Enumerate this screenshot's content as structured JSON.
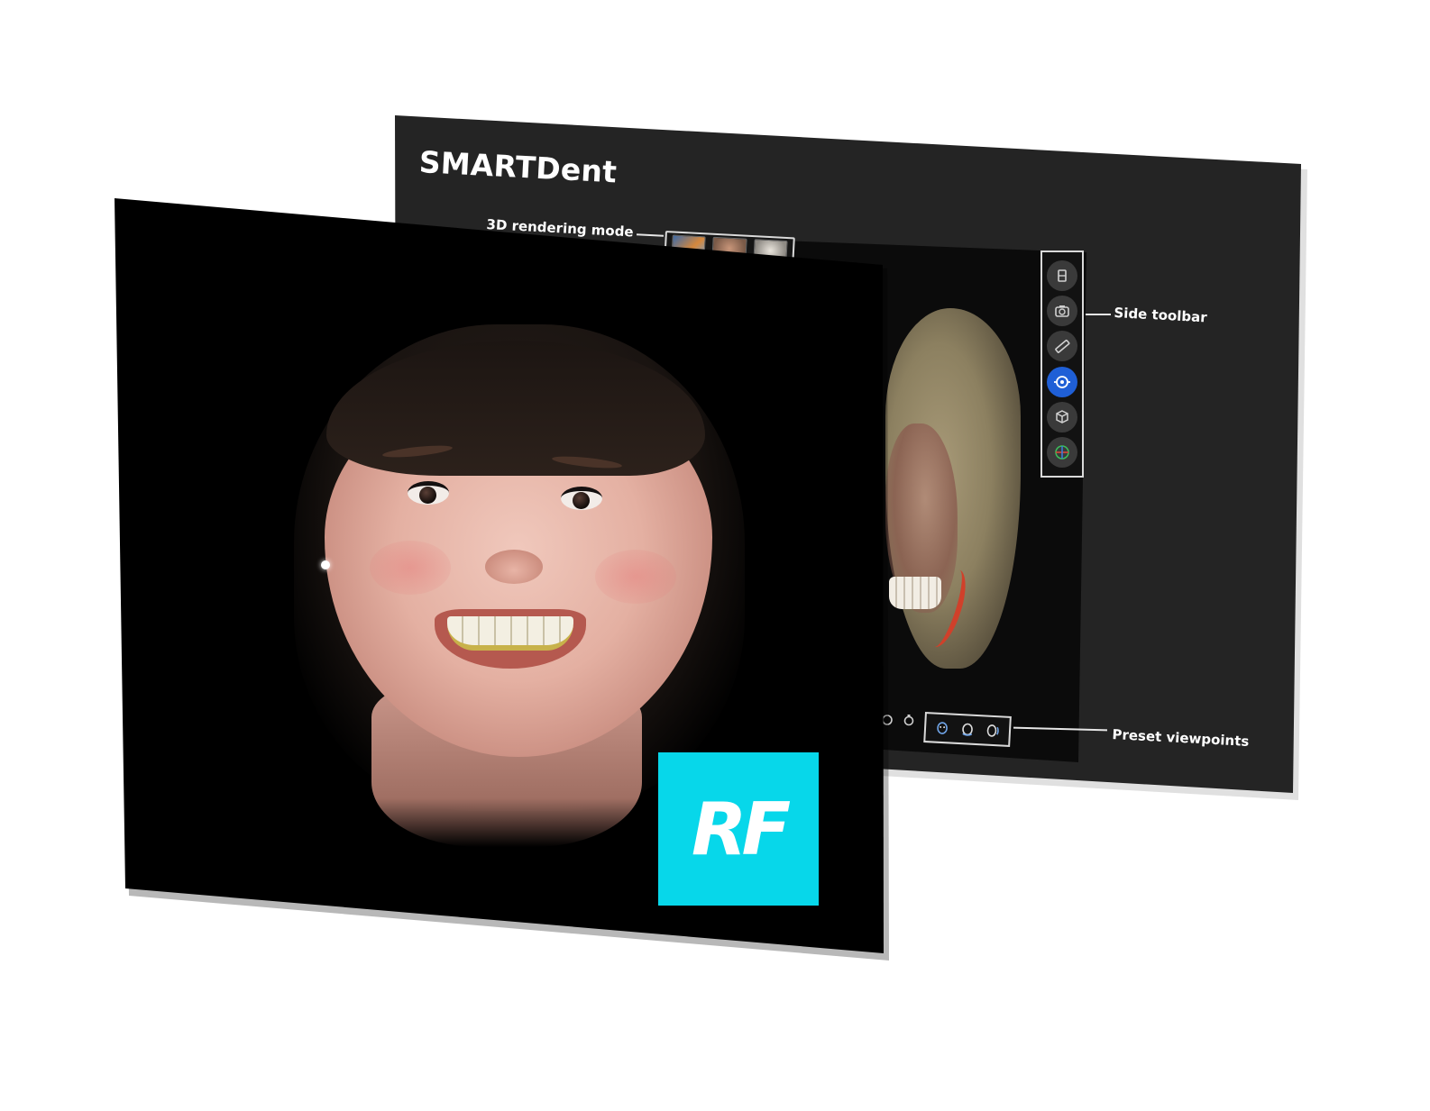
{
  "app_title": "SMARTDent",
  "callouts": {
    "render_mode": "3D rendering mode",
    "side_toolbar": "Side toolbar",
    "preset_viewpoints": "Preset viewpoints"
  },
  "render_modes": [
    {
      "name": "layered-render-mode"
    },
    {
      "name": "textured-face-render-mode"
    },
    {
      "name": "skull-render-mode"
    }
  ],
  "side_toolbar_tools": [
    {
      "icon": "layers-icon",
      "active": false
    },
    {
      "icon": "camera-icon",
      "active": false
    },
    {
      "icon": "ruler-icon",
      "active": false
    },
    {
      "icon": "orbit-rotate-icon",
      "active": true
    },
    {
      "icon": "cube-view-icon",
      "active": false
    },
    {
      "icon": "axes-gizmo-icon",
      "active": false
    }
  ],
  "preset_viewpoints": [
    {
      "icon": "front-face-view-icon"
    },
    {
      "icon": "side-face-view-icon"
    },
    {
      "icon": "three-quarter-view-icon"
    }
  ],
  "logo_text": "RF",
  "colors": {
    "back_panel": "#242424",
    "active_tool": "#1f5fd6",
    "logo_bg": "#07d7ea",
    "callout_text": "#ffffff"
  }
}
